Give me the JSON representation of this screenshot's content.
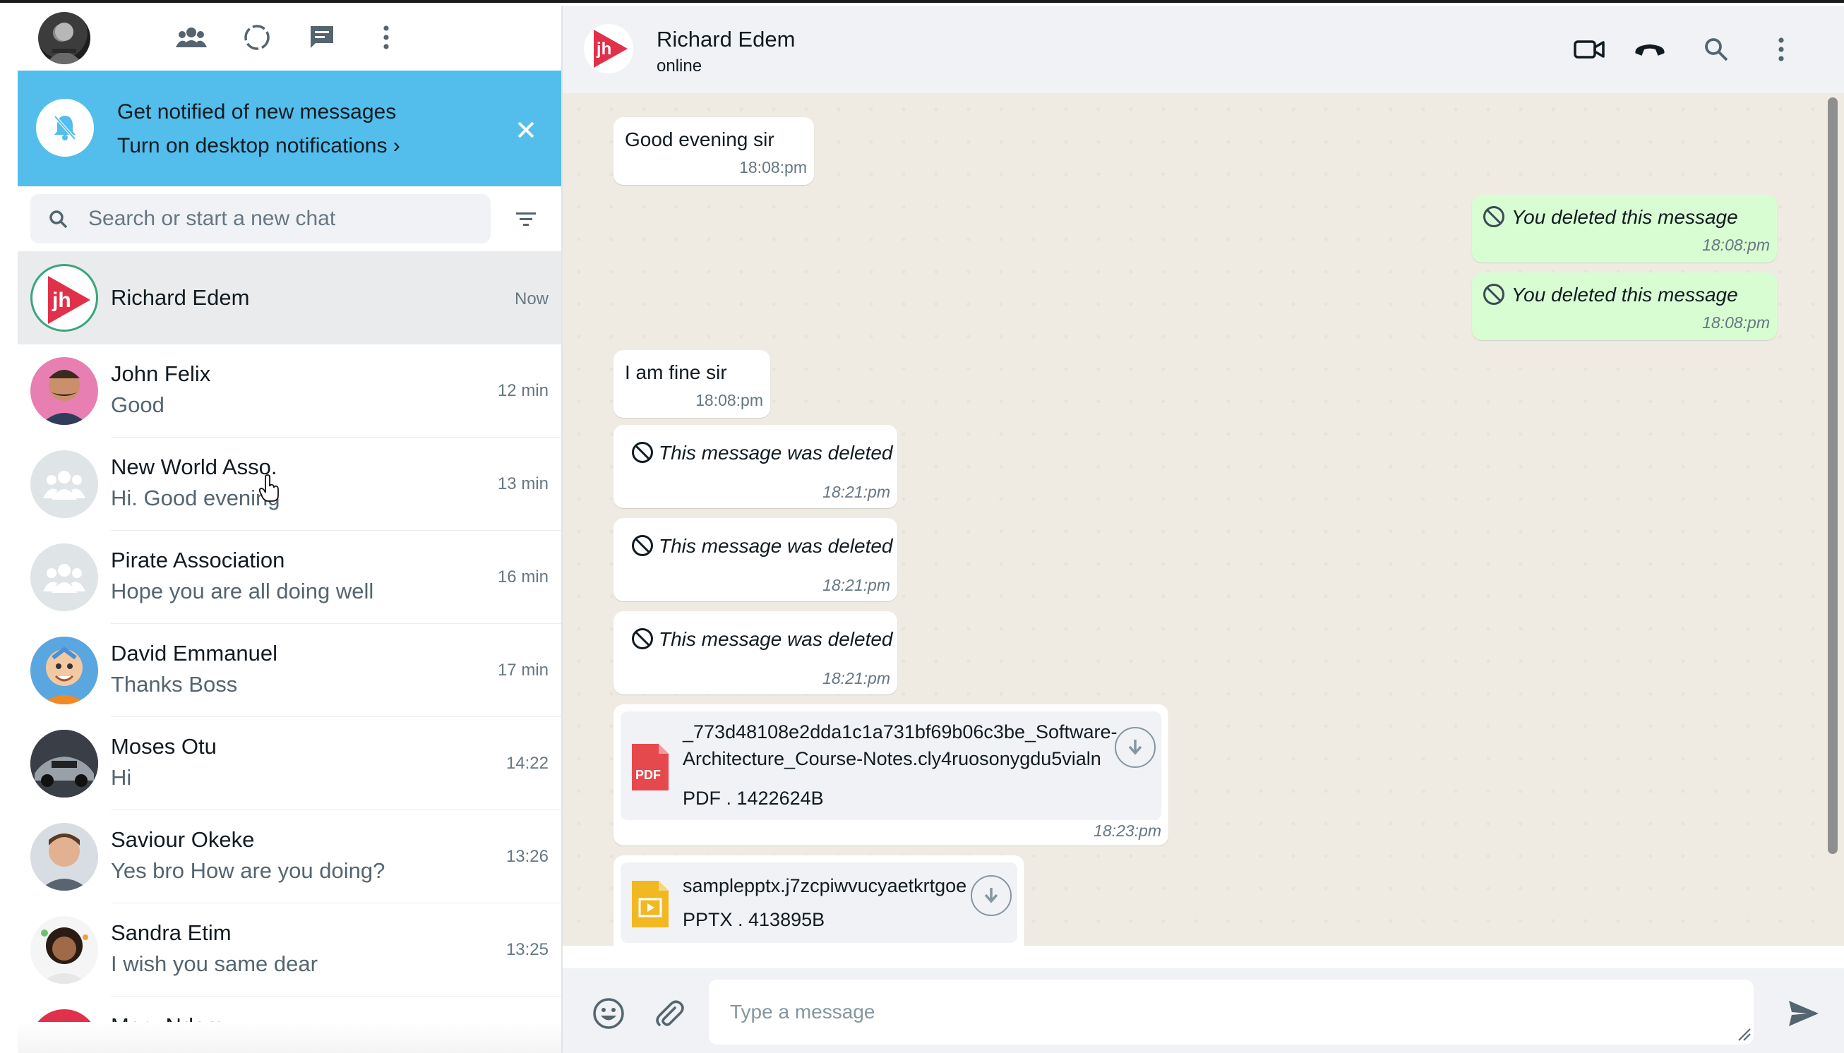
{
  "header": {
    "profile_alt": "profile",
    "icons": [
      "communities-icon",
      "status-icon",
      "new-chat-icon",
      "menu-icon"
    ]
  },
  "notification": {
    "title": "Get notified of new messages",
    "link": "Turn on desktop notifications ›"
  },
  "search": {
    "placeholder": "Search or start a new chat"
  },
  "chats": [
    {
      "name": "Richard Edem",
      "preview": "",
      "time": "Now"
    },
    {
      "name": "John Felix",
      "preview": "Good",
      "time": "12 min"
    },
    {
      "name": "New World Asso.",
      "preview": "Hi. Good evening",
      "time": "13 min"
    },
    {
      "name": "Pirate Association",
      "preview": "Hope you are all doing well",
      "time": "16 min"
    },
    {
      "name": "David Emmanuel",
      "preview": "Thanks Boss",
      "time": "17 min"
    },
    {
      "name": "Moses Otu",
      "preview": "Hi",
      "time": "14:22"
    },
    {
      "name": "Saviour Okeke",
      "preview": "Yes bro How are you doing?",
      "time": "13:26"
    },
    {
      "name": "Sandra Etim",
      "preview": "I wish you same dear",
      "time": "13:25"
    },
    {
      "name": "Mary Ndem",
      "preview": "",
      "time": ""
    }
  ],
  "conversation": {
    "name": "Richard Edem",
    "status": "online",
    "avatar_text": "jh"
  },
  "messages": [
    {
      "dir": "in",
      "text": "Good evening sir",
      "time": "18:08:pm"
    },
    {
      "dir": "out",
      "text": "You deleted this message",
      "time": "18:08:pm"
    },
    {
      "dir": "out",
      "text": "You deleted this message",
      "time": "18:08:pm"
    },
    {
      "dir": "in",
      "text": "I am fine sir",
      "time": "18:08:pm"
    },
    {
      "dir": "in",
      "text": "This message was deleted",
      "time": "18:21:pm"
    },
    {
      "dir": "in",
      "text": "This message was deleted",
      "time": "18:21:pm"
    },
    {
      "dir": "in",
      "text": "This message was deleted",
      "time": "18:21:pm"
    },
    {
      "dir": "in",
      "file_line1": "_773d48108e2dda1c1a731bf69b06c3be_Software-",
      "file_line2": "Architecture_Course-Notes.cly4ruosonygdu5vialn",
      "file_meta": "PDF . 1422624B",
      "file_badge": "PDF",
      "time": "18:23:pm"
    },
    {
      "dir": "in",
      "file_line1": "samplepptx.j7zcpiwvucyaetkrtgoe",
      "file_meta": "PPTX . 413895B"
    }
  ],
  "composer": {
    "placeholder": "Type a message"
  },
  "colors": {
    "notification_bg": "#53bdeb",
    "outgoing_bubble": "#d9fdd3",
    "chat_background": "#efeae2",
    "pdf_red": "#e5484d",
    "pptx_yellow": "#f2b822",
    "brand_red": "#e0314b"
  }
}
